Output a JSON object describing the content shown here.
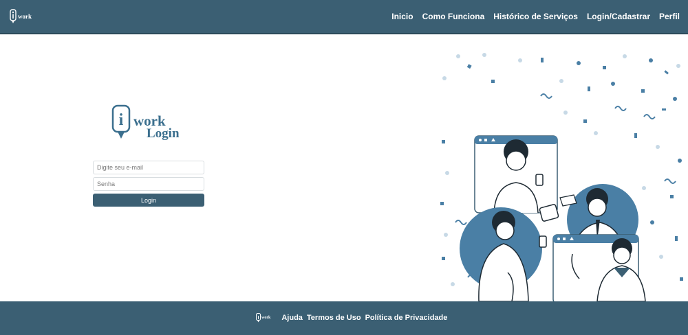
{
  "header": {
    "logo_text": "work",
    "nav": [
      {
        "label": "Inicio"
      },
      {
        "label": "Como Funciona"
      },
      {
        "label": "Histórico de Serviços"
      },
      {
        "label": "Login/Cadastrar"
      },
      {
        "label": "Perfil"
      }
    ]
  },
  "login": {
    "brand_letter": "i",
    "brand_word": "work",
    "brand_subtitle": "Login",
    "email_placeholder": "Digite seu e-mail",
    "password_placeholder": "Senha",
    "submit_label": "Login"
  },
  "illustration": {
    "icon": "people-video-call-illustration"
  },
  "footer": {
    "logo_text": "work",
    "links": [
      {
        "label": "Ajuda"
      },
      {
        "label": "Termos de Uso"
      },
      {
        "label": "Política de Privacidade"
      }
    ]
  },
  "colors": {
    "primary": "#3b5f73",
    "accent": "#4a7fa5",
    "brand_text": "#3b6f8e",
    "background": "#ffffff"
  }
}
